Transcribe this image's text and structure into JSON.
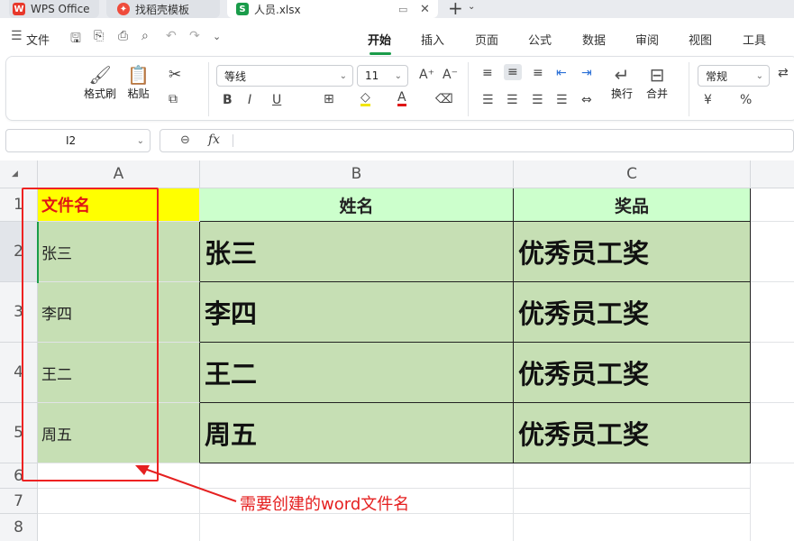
{
  "tabs": [
    {
      "label": "WPS Office",
      "icon": "wps-logo-icon"
    },
    {
      "label": "找稻壳模板",
      "icon": "docer-icon"
    },
    {
      "label": "人员.xlsx",
      "icon": "spreadsheet-s-icon"
    }
  ],
  "tab_add": "+",
  "menu": {
    "file": "文件",
    "items": [
      "开始",
      "插入",
      "页面",
      "公式",
      "数据",
      "审阅",
      "视图",
      "工具"
    ],
    "active": "开始"
  },
  "ribbon": {
    "format_painter": "格式刷",
    "paste": "粘贴",
    "font_name": "等线",
    "font_size": "11",
    "bold": "B",
    "italic": "I",
    "underline": "U",
    "wrap": "换行",
    "merge": "合并",
    "number_format": "常规",
    "currency": "¥",
    "percent": "%"
  },
  "formula_bar": {
    "name_box": "I2",
    "fx": "fx",
    "value": ""
  },
  "sheet": {
    "columns": [
      "A",
      "B",
      "C"
    ],
    "rows": [
      "1",
      "2",
      "3",
      "4",
      "5",
      "6",
      "7",
      "8"
    ],
    "header_row": [
      "文件名",
      "姓名",
      "奖品"
    ],
    "data": [
      [
        "张三",
        "张三",
        "优秀员工奖"
      ],
      [
        "李四",
        "李四",
        "优秀员工奖"
      ],
      [
        "王二",
        "王二",
        "优秀员工奖"
      ],
      [
        "周五",
        "周五",
        "优秀员工奖"
      ]
    ]
  },
  "annotation": "需要创建的word文件名",
  "colors": {
    "accent": "#1a9c4a",
    "header_fill": "#ccffcc",
    "data_fill": "#c6dfb4",
    "a1_fill": "#ffff00",
    "annotation": "#e52020"
  }
}
